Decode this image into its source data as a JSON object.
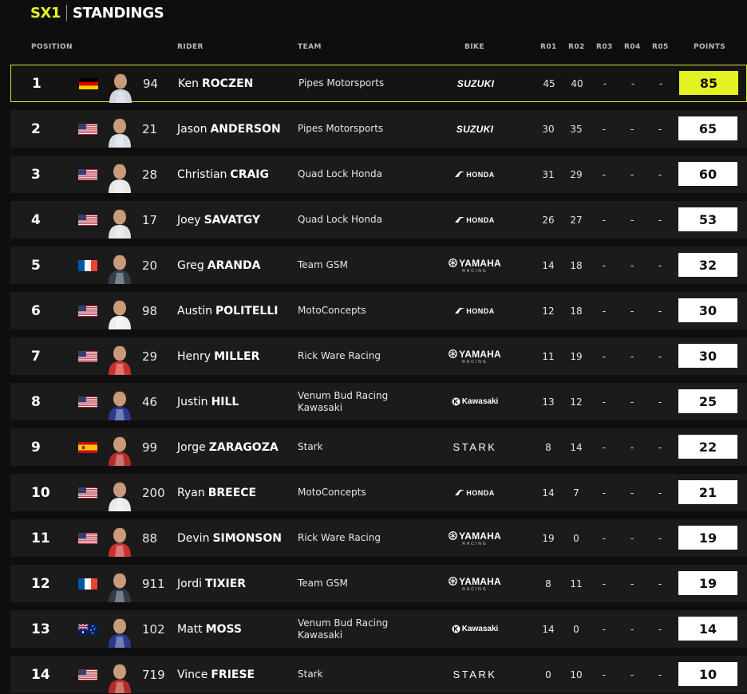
{
  "title": {
    "series": "SX1",
    "label": "STANDINGS"
  },
  "columns": {
    "position": "POSITION",
    "rider": "RIDER",
    "team": "TEAM",
    "bike": "BIKE",
    "r1": "R01",
    "r2": "R02",
    "r3": "R03",
    "r4": "R04",
    "r5": "R05",
    "points": "POINTS"
  },
  "colors": {
    "accent": "#e4f221",
    "row_bg": "#1b1b1b",
    "page_bg": "#0e0e0e"
  },
  "rows": [
    {
      "pos": "1",
      "flag": "germany",
      "num": "94",
      "first": "Ken",
      "last": "ROCZEN",
      "team": "Pipes Motorsports",
      "bike": "suzuki",
      "bike_text": "SUZUKI",
      "r1": "45",
      "r2": "40",
      "r3": "-",
      "r4": "-",
      "r5": "-",
      "points": "85",
      "jersey": "#cfd6df"
    },
    {
      "pos": "2",
      "flag": "usa",
      "num": "21",
      "first": "Jason",
      "last": "ANDERSON",
      "team": "Pipes Motorsports",
      "bike": "suzuki",
      "bike_text": "SUZUKI",
      "r1": "30",
      "r2": "35",
      "r3": "-",
      "r4": "-",
      "r5": "-",
      "points": "65",
      "jersey": "#d7dde6"
    },
    {
      "pos": "3",
      "flag": "usa",
      "num": "28",
      "first": "Christian",
      "last": "CRAIG",
      "team": "Quad Lock Honda",
      "bike": "honda",
      "bike_text": "HONDA",
      "r1": "31",
      "r2": "29",
      "r3": "-",
      "r4": "-",
      "r5": "-",
      "points": "60",
      "jersey": "#e7e7e7"
    },
    {
      "pos": "4",
      "flag": "usa",
      "num": "17",
      "first": "Joey",
      "last": "SAVATGY",
      "team": "Quad Lock Honda",
      "bike": "honda",
      "bike_text": "HONDA",
      "r1": "26",
      "r2": "27",
      "r3": "-",
      "r4": "-",
      "r5": "-",
      "points": "53",
      "jersey": "#e1e1e1"
    },
    {
      "pos": "5",
      "flag": "france",
      "num": "20",
      "first": "Greg",
      "last": "ARANDA",
      "team": "Team GSM",
      "bike": "yamaha",
      "bike_text": "YAMAHA",
      "bike_sub": "RACING",
      "r1": "14",
      "r2": "18",
      "r3": "-",
      "r4": "-",
      "r5": "-",
      "points": "32",
      "jersey": "#33404c"
    },
    {
      "pos": "6",
      "flag": "usa",
      "num": "98",
      "first": "Austin",
      "last": "POLITELLI",
      "team": "MotoConcepts",
      "bike": "honda",
      "bike_text": "HONDA",
      "r1": "12",
      "r2": "18",
      "r3": "-",
      "r4": "-",
      "r5": "-",
      "points": "30",
      "jersey": "#eeeeee"
    },
    {
      "pos": "7",
      "flag": "usa",
      "num": "29",
      "first": "Henry",
      "last": "MILLER",
      "team": "Rick Ware Racing",
      "bike": "yamaha",
      "bike_text": "YAMAHA",
      "bike_sub": "RACING",
      "r1": "11",
      "r2": "19",
      "r3": "-",
      "r4": "-",
      "r5": "-",
      "points": "30",
      "jersey": "#c9302c"
    },
    {
      "pos": "8",
      "flag": "usa",
      "num": "46",
      "first": "Justin",
      "last": "HILL",
      "team": "Venum Bud Racing Kawasaki",
      "bike": "kawasaki",
      "bike_text": "Kawasaki",
      "r1": "13",
      "r2": "12",
      "r3": "-",
      "r4": "-",
      "r5": "-",
      "points": "25",
      "jersey": "#2a3a8c"
    },
    {
      "pos": "9",
      "flag": "spain",
      "num": "99",
      "first": "Jorge",
      "last": "ZARAGOZA",
      "team": "Stark",
      "bike": "stark",
      "bike_text": "STARK",
      "r1": "8",
      "r2": "14",
      "r3": "-",
      "r4": "-",
      "r5": "-",
      "points": "22",
      "jersey": "#b32d28"
    },
    {
      "pos": "10",
      "flag": "usa",
      "num": "200",
      "first": "Ryan",
      "last": "BREECE",
      "team": "MotoConcepts",
      "bike": "honda",
      "bike_text": "HONDA",
      "r1": "14",
      "r2": "7",
      "r3": "-",
      "r4": "-",
      "r5": "-",
      "points": "21",
      "jersey": "#e9e9e9"
    },
    {
      "pos": "11",
      "flag": "usa",
      "num": "88",
      "first": "Devin",
      "last": "SIMONSON",
      "team": "Rick Ware Racing",
      "bike": "yamaha",
      "bike_text": "YAMAHA",
      "bike_sub": "RACING",
      "r1": "19",
      "r2": "0",
      "r3": "-",
      "r4": "-",
      "r5": "-",
      "points": "19",
      "jersey": "#c9302c"
    },
    {
      "pos": "12",
      "flag": "france",
      "num": "911",
      "first": "Jordi",
      "last": "TIXIER",
      "team": "Team GSM",
      "bike": "yamaha",
      "bike_text": "YAMAHA",
      "bike_sub": "RACING",
      "r1": "8",
      "r2": "11",
      "r3": "-",
      "r4": "-",
      "r5": "-",
      "points": "19",
      "jersey": "#2f3b46"
    },
    {
      "pos": "13",
      "flag": "australia",
      "num": "102",
      "first": "Matt",
      "last": "MOSS",
      "team": "Venum Bud Racing Kawasaki",
      "bike": "kawasaki",
      "bike_text": "Kawasaki",
      "r1": "14",
      "r2": "0",
      "r3": "-",
      "r4": "-",
      "r5": "-",
      "points": "14",
      "jersey": "#2a3a8c"
    },
    {
      "pos": "14",
      "flag": "usa",
      "num": "719",
      "first": "Vince",
      "last": "FRIESE",
      "team": "Stark",
      "bike": "stark",
      "bike_text": "STARK",
      "r1": "0",
      "r2": "10",
      "r3": "-",
      "r4": "-",
      "r5": "-",
      "points": "10",
      "jersey": "#b32d28"
    }
  ]
}
